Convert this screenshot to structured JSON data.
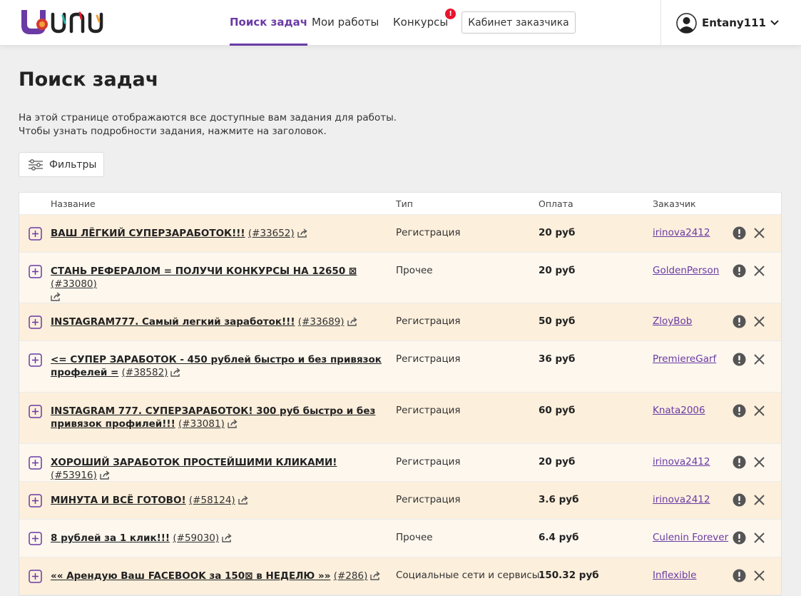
{
  "header": {
    "logo_text": "UNU",
    "nav": [
      {
        "label": "Поиск задач",
        "active": true
      },
      {
        "label": "Мои работы",
        "active": false
      },
      {
        "label": "Конкурсы",
        "active": false,
        "badge": "!"
      }
    ],
    "cabinet_label": "Кабинет заказчика",
    "username": "Entany111"
  },
  "page": {
    "title": "Поиск задач",
    "desc_line1": "На этой странице отображаются все доступные вам задания для работы.",
    "desc_line2": "Чтобы узнать подробности задания, нажмите на заголовок.",
    "filters_label": "Фильтры"
  },
  "table": {
    "columns": {
      "name": "Название",
      "type": "Тип",
      "pay": "Оплата",
      "customer": "Заказчик"
    },
    "rows": [
      {
        "title": "ВАШ ЛЁГКИЙ СУПЕРЗАРАБОТОК!!!",
        "id": "(#33652)",
        "type": "Регистрация",
        "pay": "20 руб",
        "customer": "irinova2412"
      },
      {
        "title": "СТАНЬ РЕФЕРАЛОМ = ПОЛУЧИ КОНКУРСЫ НА 12650 ⊠",
        "id": "(#33080)",
        "type": "Прочее",
        "pay": "20 руб",
        "customer": "GoldenPerson"
      },
      {
        "title": "INSTAGRAM777. Самый легкий заработок!!!",
        "id": "(#33689)",
        "type": "Регистрация",
        "pay": "50 руб",
        "customer": "ZloyBob"
      },
      {
        "title": "<= СУПЕР ЗАРАБОТОК - 450 рублей быстро и без привязок профелей =",
        "id": "(#38582)",
        "type": "Регистрация",
        "pay": "36 руб",
        "customer": "PremiereGarf"
      },
      {
        "title": "INSTAGRAM 777. СУПЕРЗАРАБОТОК! 300 руб быстро и без привязок профилей!!!",
        "id": "(#33081)",
        "type": "Регистрация",
        "pay": "60 руб",
        "customer": "Knata2006"
      },
      {
        "title": "ХОРОШИЙ ЗАРАБОТОК ПРОСТЕЙШИМИ КЛИКАМИ!",
        "id": "(#53916)",
        "type": "Регистрация",
        "pay": "20 руб",
        "customer": "irinova2412"
      },
      {
        "title": "МИНУТА И ВСЁ ГОТОВО!",
        "id": "(#58124)",
        "type": "Регистрация",
        "pay": "3.6 руб",
        "customer": "irinova2412"
      },
      {
        "title": "8 рублей за 1 клик!!!",
        "id": "(#59030)",
        "type": "Прочее",
        "pay": "6.4 руб",
        "customer": "Culenin Forever"
      },
      {
        "title": "«« Арендую Ваш FACEBOOK за 150⊠ в НЕДЕЛЮ »»",
        "id": "(#286)",
        "type": "Социальные сети и сервисы",
        "pay": "150.32 руб",
        "customer": "Inflexible"
      }
    ]
  }
}
